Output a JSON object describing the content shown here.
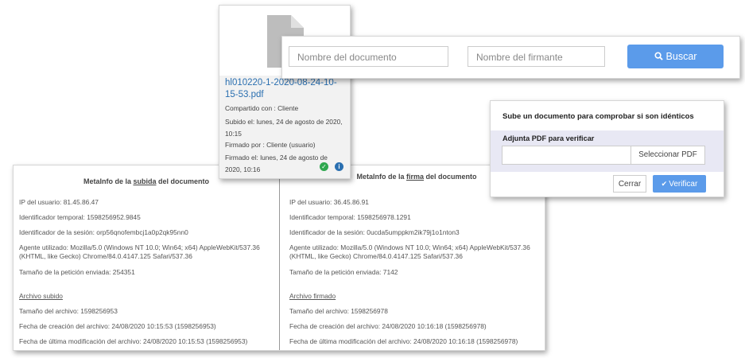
{
  "file_card": {
    "filename": "hl010220-1-2020-08-24-10-15-53.pdf",
    "shared_with": "Compartido con : Cliente",
    "uploaded": "Subido el: lunes, 24 de agosto de 2020, 10:15",
    "signed_by": "Firmado por : Cliente (usuario)",
    "signed_on": "Firmado el: lunes, 24 de agosto de 2020, 10:16",
    "icons": [
      "document-icon",
      "check-icon",
      "info-icon"
    ]
  },
  "search": {
    "doc_placeholder": "Nombre del documento",
    "signer_placeholder": "Nombre del firmante",
    "button_label": "Buscar"
  },
  "verify": {
    "title": "Sube un documento para comprobar si son idénticos",
    "attach_label": "Adjunta PDF para verificar",
    "select_label": "Seleccionar PDF",
    "close_label": "Cerrar",
    "verify_label": "Verificar"
  },
  "meta_upload": {
    "title_pre": "MetaInfo de la ",
    "title_u": "subida",
    "title_post": " del documento",
    "ip": "IP del usuario: 81.45.86.47",
    "temp_id": "Identificador temporal: 1598256952.9845",
    "session_id": "Identificador de la sesión: orp56qnofembcj1a0p2qk95nn0",
    "agent1": "Agente utilizado: Mozilla/5.0 (Windows NT 10.0; Win64; x64) AppleWebKit/537.36",
    "agent2": "(KHTML, like Gecko) Chrome/84.0.4147.125 Safari/537.36",
    "req_size": "Tamaño de la petición enviada: 254351",
    "section": "Archivo subido",
    "file_size": "Tamaño del archivo: 1598256953",
    "created": "Fecha de creación del archivo: 24/08/2020 10:15:53 (1598256953)",
    "modified": "Fecha de última modificación del archivo: 24/08/2020 10:15:53 (1598256953)"
  },
  "meta_sign": {
    "title_pre": "MetaInfo de la ",
    "title_u": "firma",
    "title_post": " del documento",
    "ip": "IP del usuario: 36.45.86.91",
    "temp_id": "Identificador temporal: 1598256978.1291",
    "session_id": "Identificador de la sesión: 0ucda5umppkm2ik79j1o1nton3",
    "agent1": "Agente utilizado: Mozilla/5.0 (Windows NT 10.0; Win64; x64) AppleWebKit/537.36",
    "agent2": "(KHTML, like Gecko) Chrome/84.0.4147.125 Safari/537.36",
    "req_size": "Tamaño de la petición enviada: 7142",
    "section": "Archivo firmado",
    "file_size": "Tamaño del archivo: 1598256978",
    "created": "Fecha de creación del archivo: 24/08/2020 10:16:18 (1598256978)",
    "modified": "Fecha de última modificación del archivo: 24/08/2020 10:16:18 (1598256978)"
  },
  "colors": {
    "accent": "#5b9bea",
    "link": "#2a6fb0",
    "success": "#2fa84f"
  }
}
